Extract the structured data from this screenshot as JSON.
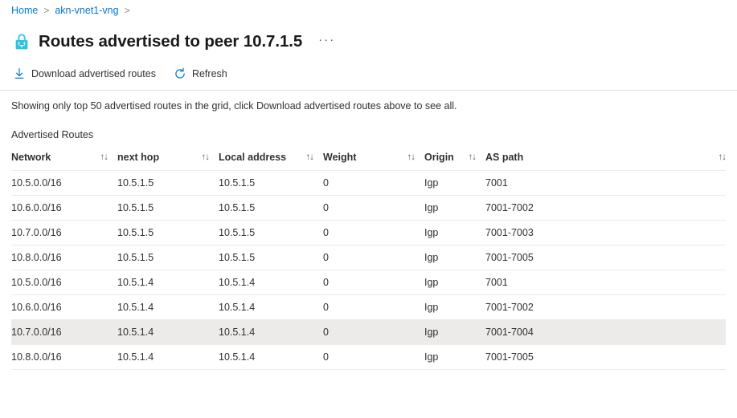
{
  "breadcrumb": {
    "items": [
      {
        "label": "Home",
        "link": true
      },
      {
        "label": "akn-vnet1-vng",
        "link": true
      }
    ],
    "separator": ">"
  },
  "header": {
    "icon": "vpn-gateway-padlock-icon",
    "title": "Routes advertised to peer 10.7.1.5",
    "more_menu": "···"
  },
  "toolbar": {
    "download_label": "Download advertised routes",
    "download_icon": "download-icon",
    "refresh_label": "Refresh",
    "refresh_icon": "refresh-icon"
  },
  "notice": "Showing only top 50 advertised routes in the grid, click Download advertised routes above to see all.",
  "section_title": "Advertised Routes",
  "table": {
    "sort_icon": "↑↓",
    "columns": [
      {
        "label": "Network",
        "sortable": true
      },
      {
        "label": "next hop",
        "sortable": true
      },
      {
        "label": "Local address",
        "sortable": true
      },
      {
        "label": "Weight",
        "sortable": true
      },
      {
        "label": "Origin",
        "sortable": true
      },
      {
        "label": "AS path",
        "sortable": true
      }
    ],
    "rows": [
      {
        "network": "10.5.0.0/16",
        "next_hop": "10.5.1.5",
        "local_address": "10.5.1.5",
        "weight": "0",
        "origin": "Igp",
        "as_path": "7001",
        "selected": false
      },
      {
        "network": "10.6.0.0/16",
        "next_hop": "10.5.1.5",
        "local_address": "10.5.1.5",
        "weight": "0",
        "origin": "Igp",
        "as_path": "7001-7002",
        "selected": false
      },
      {
        "network": "10.7.0.0/16",
        "next_hop": "10.5.1.5",
        "local_address": "10.5.1.5",
        "weight": "0",
        "origin": "Igp",
        "as_path": "7001-7003",
        "selected": false
      },
      {
        "network": "10.8.0.0/16",
        "next_hop": "10.5.1.5",
        "local_address": "10.5.1.5",
        "weight": "0",
        "origin": "Igp",
        "as_path": "7001-7005",
        "selected": false
      },
      {
        "network": "10.5.0.0/16",
        "next_hop": "10.5.1.4",
        "local_address": "10.5.1.4",
        "weight": "0",
        "origin": "Igp",
        "as_path": "7001",
        "selected": false
      },
      {
        "network": "10.6.0.0/16",
        "next_hop": "10.5.1.4",
        "local_address": "10.5.1.4",
        "weight": "0",
        "origin": "Igp",
        "as_path": "7001-7002",
        "selected": false
      },
      {
        "network": "10.7.0.0/16",
        "next_hop": "10.5.1.4",
        "local_address": "10.5.1.4",
        "weight": "0",
        "origin": "Igp",
        "as_path": "7001-7004",
        "selected": true
      },
      {
        "network": "10.8.0.0/16",
        "next_hop": "10.5.1.4",
        "local_address": "10.5.1.4",
        "weight": "0",
        "origin": "Igp",
        "as_path": "7001-7005",
        "selected": false
      }
    ]
  },
  "colors": {
    "link": "#0078d4",
    "accent_icon": "#32c8e8",
    "text": "#323130",
    "border": "#edebe9",
    "row_selected": "#edebe9",
    "background": "#ffffff"
  }
}
